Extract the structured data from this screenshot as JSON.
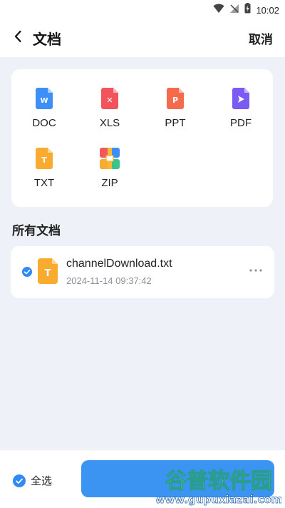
{
  "status": {
    "time": "10:02"
  },
  "header": {
    "title": "文档",
    "cancel": "取消"
  },
  "types": [
    {
      "label": "DOC",
      "icon": "doc-file-icon",
      "color": "#3d8ef6",
      "letter": "W"
    },
    {
      "label": "XLS",
      "icon": "xls-file-icon",
      "color": "#f2545b",
      "letter": "✕"
    },
    {
      "label": "PPT",
      "icon": "ppt-file-icon",
      "color": "#f56a4c",
      "letter": "P"
    },
    {
      "label": "PDF",
      "icon": "pdf-file-icon",
      "color": "#7a5cf4",
      "letter": "▶"
    },
    {
      "label": "TXT",
      "icon": "txt-file-icon",
      "color": "#f8ab2f",
      "letter": "T"
    },
    {
      "label": "ZIP",
      "icon": "zip-file-icon",
      "color": "#f05a5a",
      "letter": ""
    }
  ],
  "section": {
    "title": "所有文档"
  },
  "files": [
    {
      "name": "channelDownload.txt",
      "date": "2024-11-14 09:37:42",
      "selected": true
    }
  ],
  "footer": {
    "select_all": "全选"
  },
  "colors": {
    "accent": "#2f8af5",
    "background": "#eef1f8"
  },
  "watermark": {
    "line1": "谷普软件园",
    "line2": "www.gupuxiazai.com"
  }
}
